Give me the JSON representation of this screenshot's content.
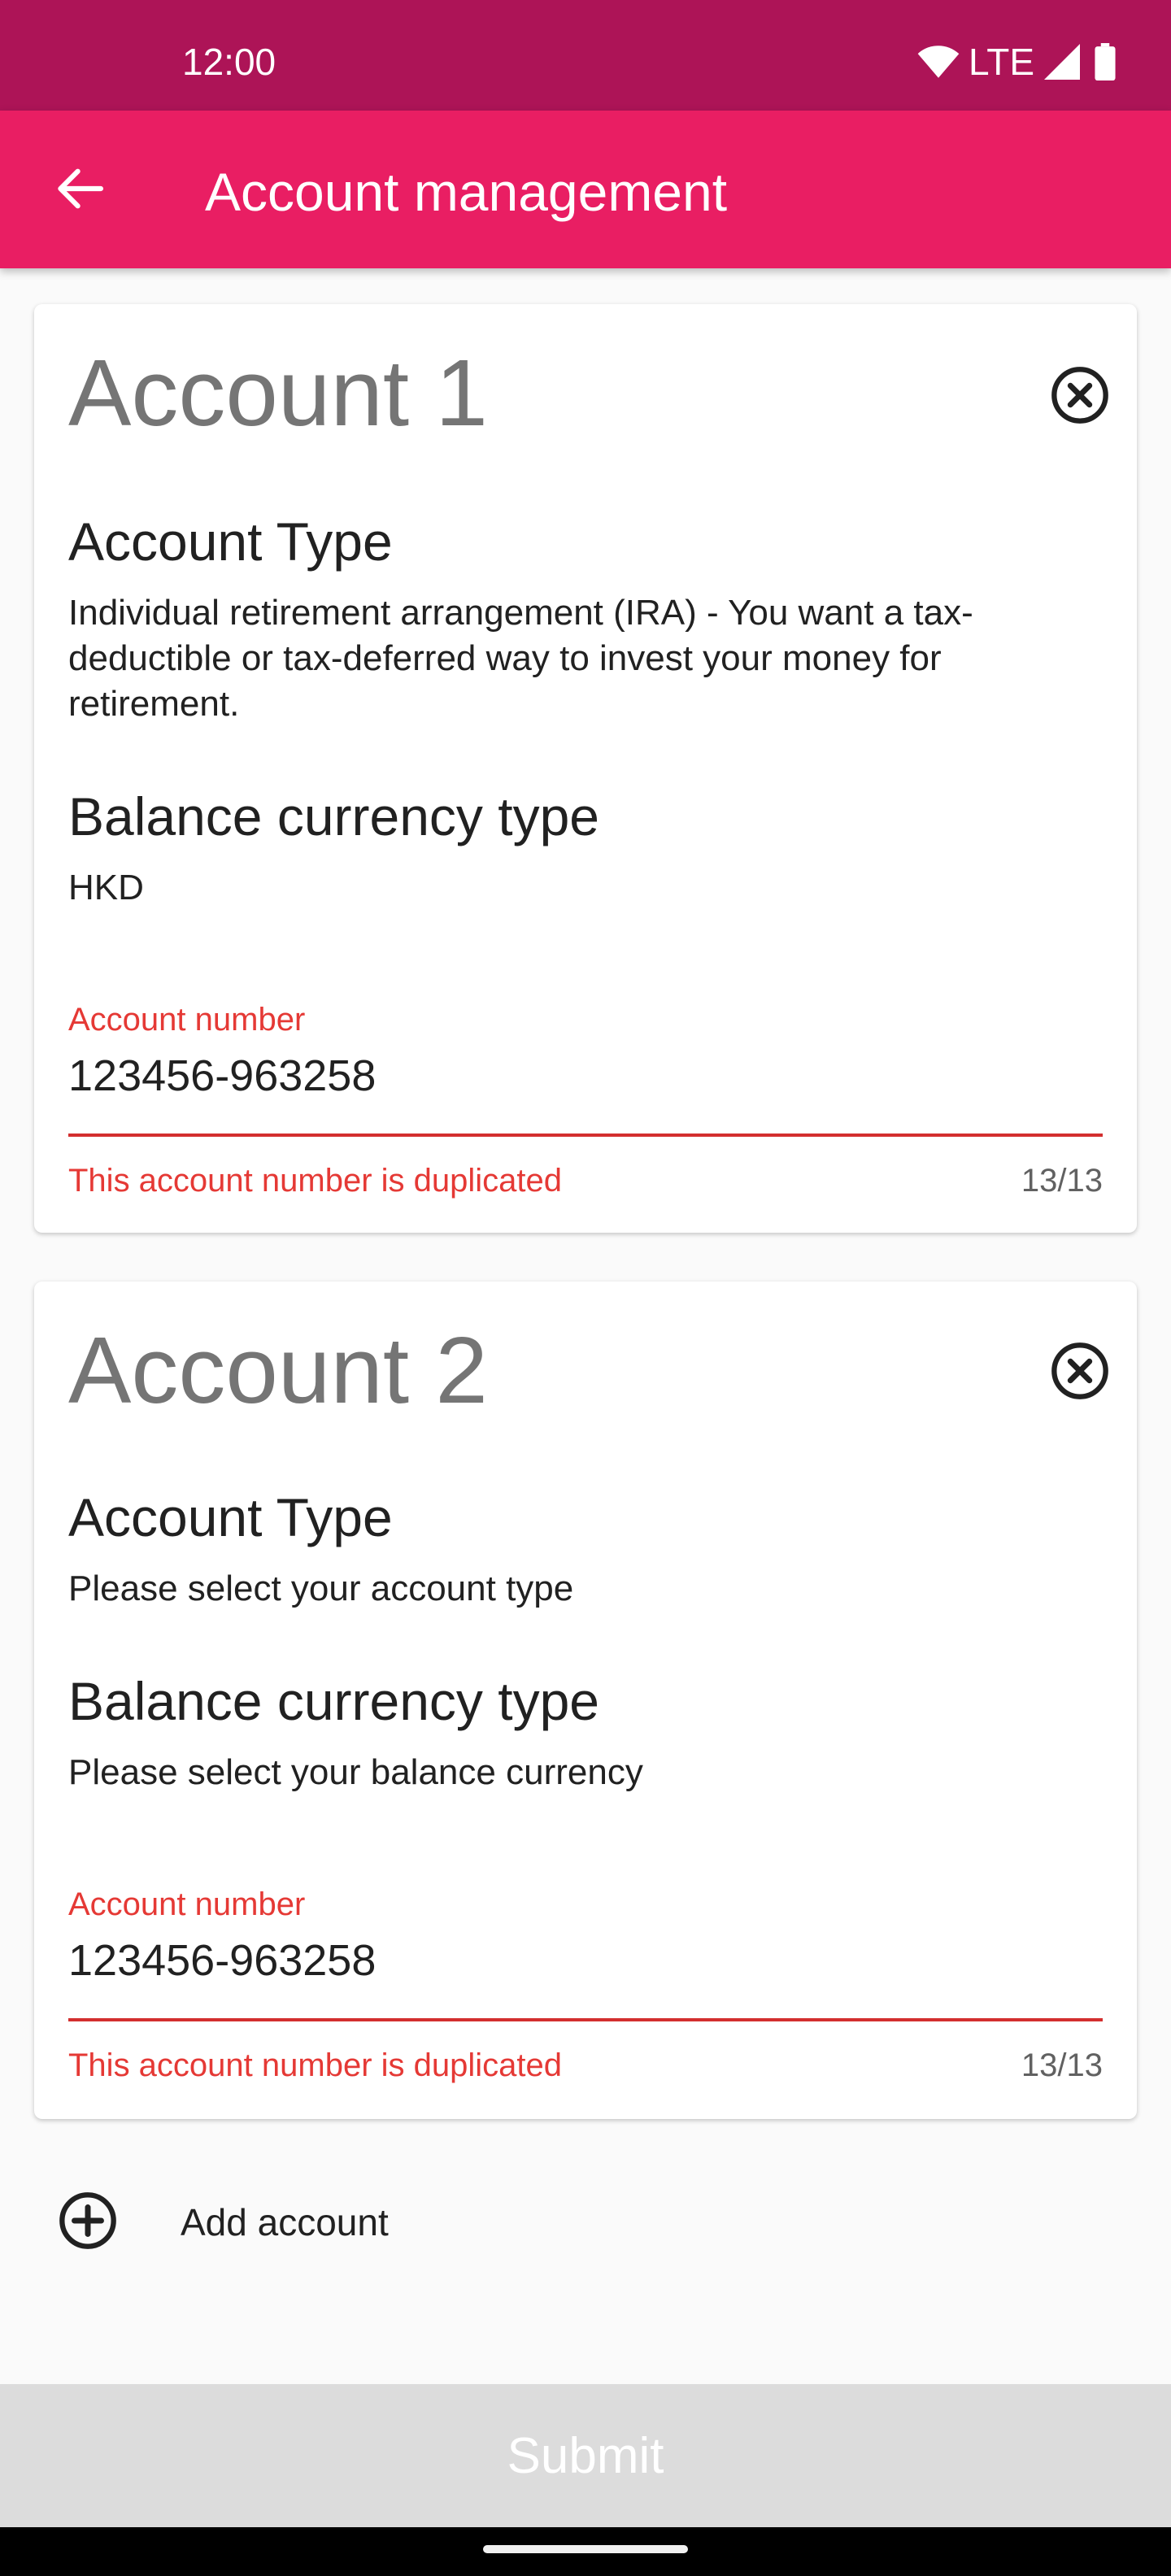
{
  "status_bar": {
    "time": "12:00",
    "network": "LTE",
    "icons": [
      "wifi-icon",
      "signal-icon",
      "battery-icon"
    ]
  },
  "app_bar": {
    "title": "Account management",
    "back_icon": "arrow-back-icon"
  },
  "accounts": [
    {
      "title": "Account 1",
      "remove_icon": "close-circle-icon",
      "account_type_heading": "Account Type",
      "account_type_value": "Individual retirement arrangement (IRA) - You want a tax-deductible or tax-deferred way to invest your money for retirement.",
      "currency_heading": "Balance currency type",
      "currency_value": "HKD",
      "account_number_label": "Account number",
      "account_number_value": "123456-963258",
      "error": "This account number is duplicated",
      "counter": "13/13"
    },
    {
      "title": "Account 2",
      "remove_icon": "close-circle-icon",
      "account_type_heading": "Account Type",
      "account_type_value": "Please select your account type",
      "currency_heading": "Balance currency type",
      "currency_value": "Please select your balance currency",
      "account_number_label": "Account number",
      "account_number_value": "123456-963258",
      "error": "This account number is duplicated",
      "counter": "13/13"
    }
  ],
  "add_account": {
    "label": "Add account",
    "icon": "add-circle-icon"
  },
  "submit": {
    "label": "Submit",
    "enabled": false
  },
  "colors": {
    "status_bar": "#ad1457",
    "app_bar": "#e91e63",
    "error": "#e53935",
    "disabled_button": "#dcdcdc"
  }
}
